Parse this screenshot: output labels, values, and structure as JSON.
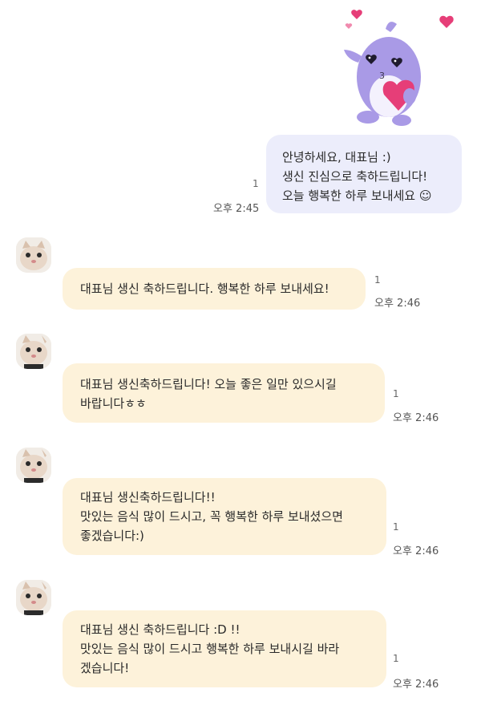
{
  "sticker": {
    "icon": "purple-character-heart-sticker"
  },
  "outgoing": {
    "lines": [
      "안녕하세요, 대표님 :)",
      "생신 진심으로 축하드립니다!",
      "오늘 행복한 하루 보내세요 ☺"
    ],
    "read_count": "1",
    "time": "오후 2:45"
  },
  "incoming": [
    {
      "lines": [
        "대표님 생신 축하드립니다. 행복한 하루 보내세요!"
      ],
      "read_count": "1",
      "time": "오후 2:46"
    },
    {
      "lines": [
        "대표님 생신축하드립니다! 오늘 좋은 일만 있으시길",
        "바랍니다ㅎㅎ"
      ],
      "read_count": "1",
      "time": "오후 2:46"
    },
    {
      "lines": [
        "대표님 생신축하드립니다!!",
        "맛있는 음식 많이 드시고, 꼭 행복한 하루 보내셨으면",
        "좋겠습니다:)"
      ],
      "read_count": "1",
      "time": "오후 2:46"
    },
    {
      "lines": [
        "대표님 생신 축하드립니다 :D !!",
        "맛있는 음식 많이 드시고 행복한 하루 보내시길 바라",
        "겠습니다!"
      ],
      "read_count": "1",
      "time": "오후 2:46"
    }
  ],
  "colors": {
    "outgoing_bubble": "#ecedfb",
    "incoming_bubble": "#fdf2da",
    "sticker_body": "#a99ae6",
    "heart": "#e63e78"
  }
}
